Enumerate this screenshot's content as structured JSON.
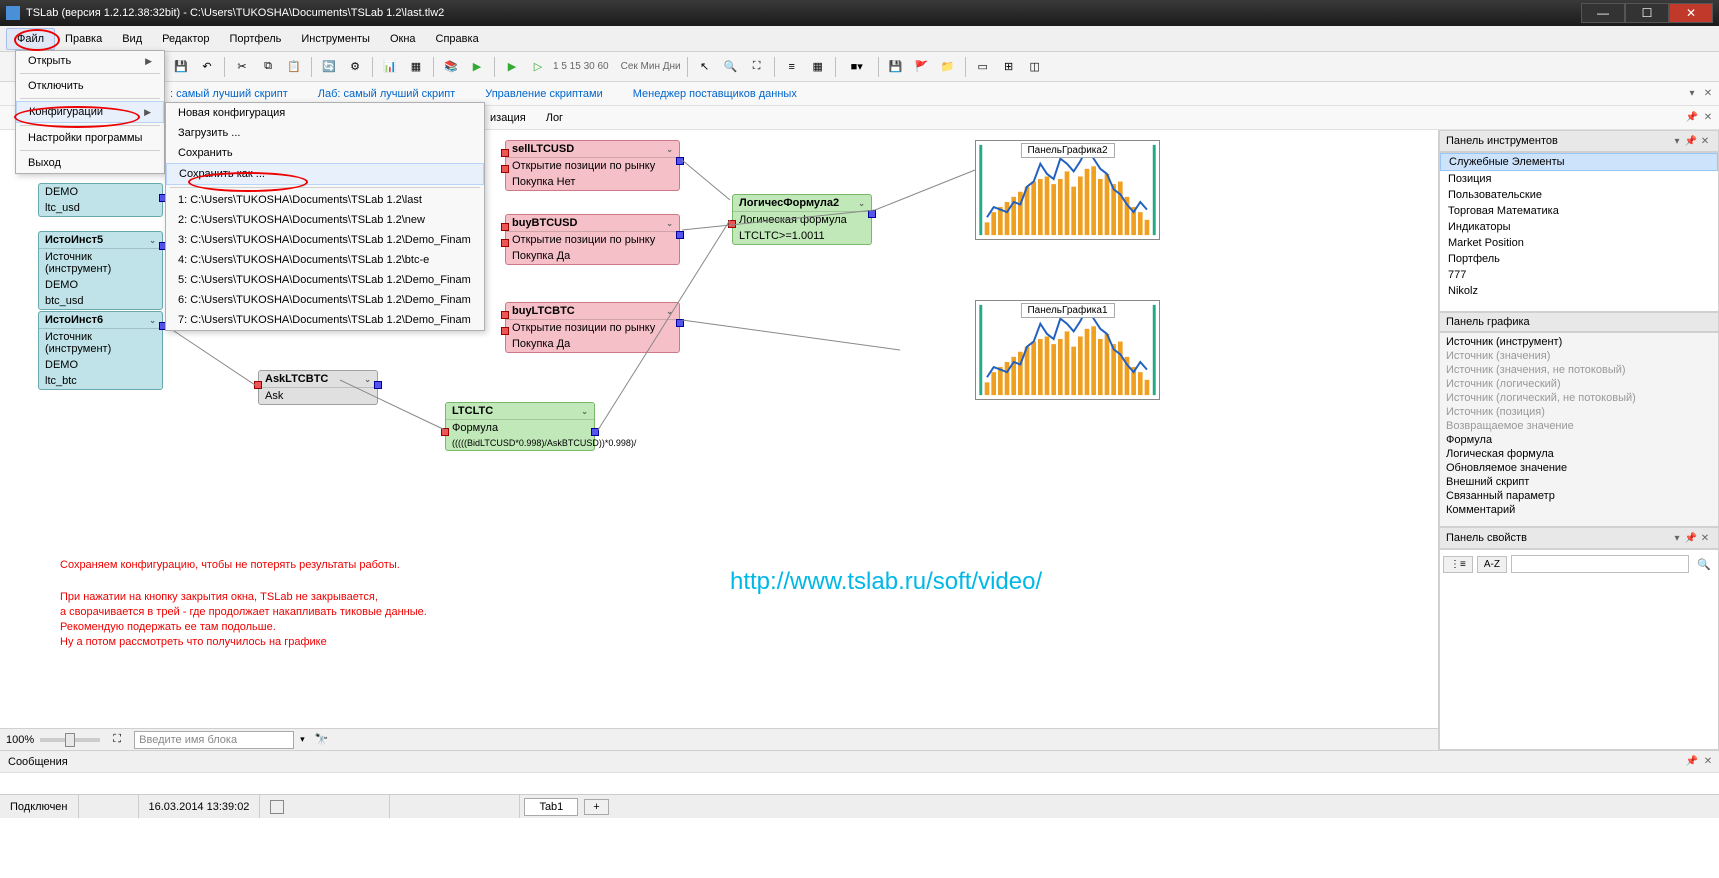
{
  "window": {
    "title": "TSLab (версия 1.2.12.38:32bit) - C:\\Users\\TUKOSHA\\Documents\\TSLab 1.2\\last.tlw2"
  },
  "menu": {
    "items": [
      "Файл",
      "Правка",
      "Вид",
      "Редактор",
      "Портфель",
      "Инструменты",
      "Окна",
      "Справка"
    ]
  },
  "file_menu": {
    "open": "Открыть",
    "disconnect": "Отключить",
    "config": "Конфигурации",
    "settings": "Настройки программы",
    "exit": "Выход"
  },
  "config_submenu": {
    "new_config": "Новая конфигурация",
    "load": "Загрузить ...",
    "save": "Сохранить",
    "save_as": "Сохранить как ...",
    "recent": [
      "1:  C:\\Users\\TUKOSHA\\Documents\\TSLab 1.2\\last",
      "2:  C:\\Users\\TUKOSHA\\Documents\\TSLab 1.2\\new",
      "3:  C:\\Users\\TUKOSHA\\Documents\\TSLab 1.2\\Demo_Finam",
      "4:  C:\\Users\\TUKOSHA\\Documents\\TSLab 1.2\\btc-e",
      "5:  C:\\Users\\TUKOSHA\\Documents\\TSLab 1.2\\Demo_Finam",
      "6:  C:\\Users\\TUKOSHA\\Documents\\TSLab 1.2\\Demo_Finam",
      "7:  C:\\Users\\TUKOSHA\\Documents\\TSLab 1.2\\Demo_Finam"
    ]
  },
  "subtoolbar": {
    "a": ": самый лучший скрипт",
    "b": "Лаб: самый лучший скрипт",
    "c": "Управление скриптами",
    "d": "Менеджер поставщиков данных"
  },
  "toolbar_time": {
    "nums": "1  5  15  30  60",
    "units": "Сек  Мин  Дни"
  },
  "tabs_row": [
    "изация",
    "Лог"
  ],
  "zoom": {
    "pct": "100%",
    "placeholder": "Введите имя блока"
  },
  "blocks": {
    "src_ltcusd": {
      "title": "",
      "l1": "DEMO",
      "l2": "ltc_usd"
    },
    "src5": {
      "title": "ИстоИнст5",
      "l1": "Источник (инструмент)",
      "l2": "DEMO",
      "l3": "btc_usd"
    },
    "src6": {
      "title": "ИстоИнст6",
      "l1": "Источник (инструмент)",
      "l2": "DEMO",
      "l3": "ltc_btc"
    },
    "askltcbtc": {
      "title": "AskLTCBTC",
      "l1": "Ask"
    },
    "sellltc": {
      "title": "sellLTCUSD",
      "l1": "Открытие позиции по рынку",
      "l2": "Покупка    Нет"
    },
    "buybtc": {
      "title": "buyBTCUSD",
      "l1": "Открытие позиции по рынку",
      "l2": "Покупка    Да"
    },
    "buyltcbtc": {
      "title": "buyLTCBTC",
      "l1": "Открытие позиции по рынку",
      "l2": "Покупка    Да"
    },
    "formula": {
      "title": "ЛогичесФормула2",
      "l1": "Логическая формула",
      "l2": "LTCLTC>=1.0011"
    },
    "ltcltc": {
      "title": "LTCLTC",
      "l1": "Формула",
      "l2": "(((((BidLTCUSD*0.998)/AskBTCUSD))*0.998)/"
    }
  },
  "charts": {
    "c1": "ПанельГрафика2",
    "c2": "ПанельГрафика1"
  },
  "toolbox": {
    "header": "Панель инструментов",
    "items": [
      "Служебные Элементы",
      "Позиция",
      "Пользовательские",
      "Торговая Математика",
      "Индикаторы",
      "Market Position",
      "Портфель",
      "777",
      "Nikolz"
    ]
  },
  "graph_panel_header": "Панель графика",
  "graph_panel": [
    {
      "t": "Источник (инструмент)",
      "d": false
    },
    {
      "t": "Источник (значения)",
      "d": true
    },
    {
      "t": "Источник (значения, не потоковый)",
      "d": true
    },
    {
      "t": "Источник (логический)",
      "d": true
    },
    {
      "t": "Источник (логический, не потоковый)",
      "d": true
    },
    {
      "t": "Источник (позиция)",
      "d": true
    },
    {
      "t": "Возвращаемое значение",
      "d": true
    },
    {
      "t": "Формула",
      "d": false
    },
    {
      "t": "Логическая формула",
      "d": false
    },
    {
      "t": "Обновляемое значение",
      "d": false
    },
    {
      "t": "Внешний скрипт",
      "d": false
    },
    {
      "t": "Связанный параметр",
      "d": false
    },
    {
      "t": "Комментарий",
      "d": false
    }
  ],
  "props": {
    "header": "Панель свойств",
    "az": "A-Z"
  },
  "annotation": {
    "l1": "Сохраняем конфигурацию, чтобы не потерять результаты работы.",
    "l2": "При нажатии на кнопку закрытия окна, TSLab не закрывается,",
    "l3": "а сворачивается в трей - где продолжает накапливать тиковые данные.",
    "l4": "Рекомендую подержать ее там подольше.",
    "l5": " Ну а потом рассмотреть что получилось на графике"
  },
  "url_annotation": "http://www.tslab.ru/soft/video/",
  "messages_header": "Сообщения",
  "status": {
    "conn": "Подключен",
    "ts": "16.03.2014 13:39:02",
    "tab": "Tab1",
    "add": "+"
  },
  "chart_data": [
    {
      "type": "bar+line",
      "title": "ПанельГрафика2",
      "bars": [
        10,
        18,
        22,
        26,
        30,
        34,
        38,
        42,
        44,
        46,
        40,
        44,
        50,
        38,
        46,
        52,
        54,
        44,
        48,
        40,
        42,
        30,
        22,
        18,
        12
      ],
      "line": [
        14,
        22,
        20,
        18,
        26,
        24,
        38,
        42,
        56,
        48,
        44,
        60,
        56,
        50,
        58,
        68,
        60,
        52,
        48,
        36,
        32,
        24,
        18,
        26,
        20
      ]
    },
    {
      "type": "bar+line",
      "title": "ПанельГрафика1",
      "bars": [
        10,
        18,
        22,
        26,
        30,
        34,
        38,
        42,
        44,
        46,
        40,
        44,
        50,
        38,
        46,
        52,
        54,
        44,
        48,
        40,
        42,
        30,
        22,
        18,
        12
      ],
      "line": [
        14,
        22,
        20,
        18,
        26,
        24,
        38,
        42,
        56,
        48,
        44,
        60,
        56,
        50,
        58,
        68,
        60,
        52,
        48,
        36,
        32,
        24,
        18,
        26,
        20
      ]
    }
  ]
}
